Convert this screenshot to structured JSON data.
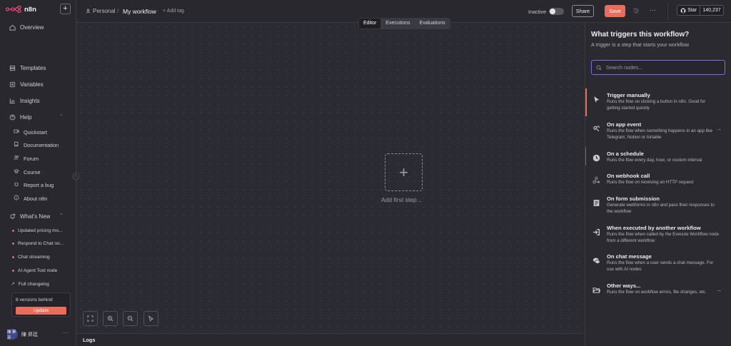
{
  "sidebar": {
    "brand": "n8n",
    "nav": [
      {
        "label": "Overview"
      },
      {
        "label": "Templates"
      },
      {
        "label": "Variables"
      },
      {
        "label": "Insights"
      },
      {
        "label": "Help"
      }
    ],
    "help_items": [
      {
        "label": "Quickstart"
      },
      {
        "label": "Documentation"
      },
      {
        "label": "Forum"
      },
      {
        "label": "Course"
      },
      {
        "label": "Report a bug"
      },
      {
        "label": "About n8n"
      }
    ],
    "whats_new": {
      "label": "What's New",
      "items": [
        {
          "label": "Updated pricing mo..."
        },
        {
          "label": "Respond to Chat no..."
        },
        {
          "label": "Chat streaming"
        },
        {
          "label": "AI Agent Tool node"
        }
      ],
      "full_changelog": "Full changelog"
    },
    "update": {
      "text": "8 versions behind",
      "button": "Update"
    },
    "user": {
      "initials": "陳 昇廷",
      "name": "陳 昇廷"
    }
  },
  "header": {
    "owner": "Personal",
    "separator": "/",
    "workflow_name": "My workflow",
    "add_tag": "+ Add tag",
    "active_label": "Inactive",
    "share": "Share",
    "save": "Save",
    "more": "···",
    "github": {
      "label": "Star",
      "count": "140,237"
    }
  },
  "tabs": [
    {
      "label": "Editor",
      "active": true
    },
    {
      "label": "Executions",
      "active": false
    },
    {
      "label": "Evaluations",
      "active": false
    }
  ],
  "canvas": {
    "add_first_symbol": "+",
    "add_first_label": "Add first step..."
  },
  "logs": {
    "label": "Logs"
  },
  "panel": {
    "title": "What triggers this workflow?",
    "subtitle": "A trigger is a step that starts your workflow",
    "search_placeholder": "Search nodes...",
    "nodes": [
      {
        "name": "Trigger manually",
        "desc": "Runs the flow on clicking a button in n8n. Good for getting started quickly",
        "icon": "cursor-icon"
      },
      {
        "name": "On app event",
        "desc": "Runs the flow when something happens in an app like Telegram, Notion or Airtable",
        "icon": "satellite-icon",
        "arrow": "→"
      },
      {
        "name": "On a schedule",
        "desc": "Runs the flow every day, hour, or custom interval",
        "icon": "clock-icon"
      },
      {
        "name": "On webhook call",
        "desc": "Runs the flow on receiving an HTTP request",
        "icon": "webhook-icon"
      },
      {
        "name": "On form submission",
        "desc": "Generate webforms in n8n and pass their responses to the workflow",
        "icon": "form-icon"
      },
      {
        "name": "When executed by another workflow",
        "desc": "Runs the flow when called by the Execute Workflow node from a different workflow",
        "icon": "sign-in-icon"
      },
      {
        "name": "On chat message",
        "desc": "Runs the flow when a user sends a chat message. For use with AI nodes",
        "icon": "chat-icon"
      },
      {
        "name": "Other ways...",
        "desc": "Runs the flow on workflow errors, file changes, etc.",
        "icon": "folder-icon",
        "arrow": "→"
      }
    ]
  },
  "colors": {
    "accent": "#ea6c5b",
    "focus": "#7c6cf0",
    "background": "#2b2b33"
  }
}
